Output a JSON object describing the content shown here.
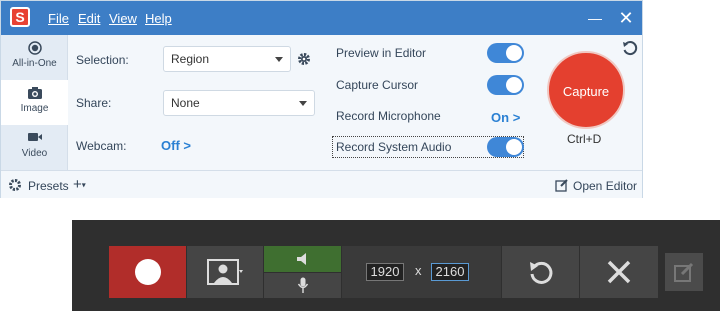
{
  "menu": {
    "file": "File",
    "edit": "Edit",
    "view": "View",
    "help": "Help"
  },
  "window_controls": {
    "minimize": "—",
    "close": "✕"
  },
  "modes": [
    {
      "label": "All-in-One",
      "icon": "target-icon",
      "active": true
    },
    {
      "label": "Image",
      "icon": "camera-icon",
      "active": false
    },
    {
      "label": "Video",
      "icon": "video-camera-icon",
      "active": false
    }
  ],
  "settings": {
    "selection_label": "Selection:",
    "selection_value": "Region",
    "share_label": "Share:",
    "share_value": "None",
    "webcam_label": "Webcam:",
    "webcam_value": "Off",
    "webcam_arrow": ">"
  },
  "options": [
    {
      "label": "Preview in Editor",
      "state": "on-toggle"
    },
    {
      "label": "Capture Cursor",
      "state": "on-toggle"
    },
    {
      "label": "Record Microphone",
      "state": "On",
      "arrow": ">"
    },
    {
      "label": "Record System Audio",
      "state": "on-toggle"
    }
  ],
  "capture": {
    "button_label": "Capture",
    "shortcut": "Ctrl+D"
  },
  "footer": {
    "presets_label": "Presets",
    "add_symbol": "+",
    "open_editor_label": "Open Editor"
  },
  "recorder": {
    "width": "1920",
    "times": "x",
    "height": "2160"
  },
  "colors": {
    "titlebar": "#3d7ec6",
    "accent": "#3f87d7",
    "capture_red": "#e4402f",
    "record_red": "#b12d2a",
    "audio_green": "#3f6f30",
    "toolbar_bg": "#2f2f2f"
  }
}
